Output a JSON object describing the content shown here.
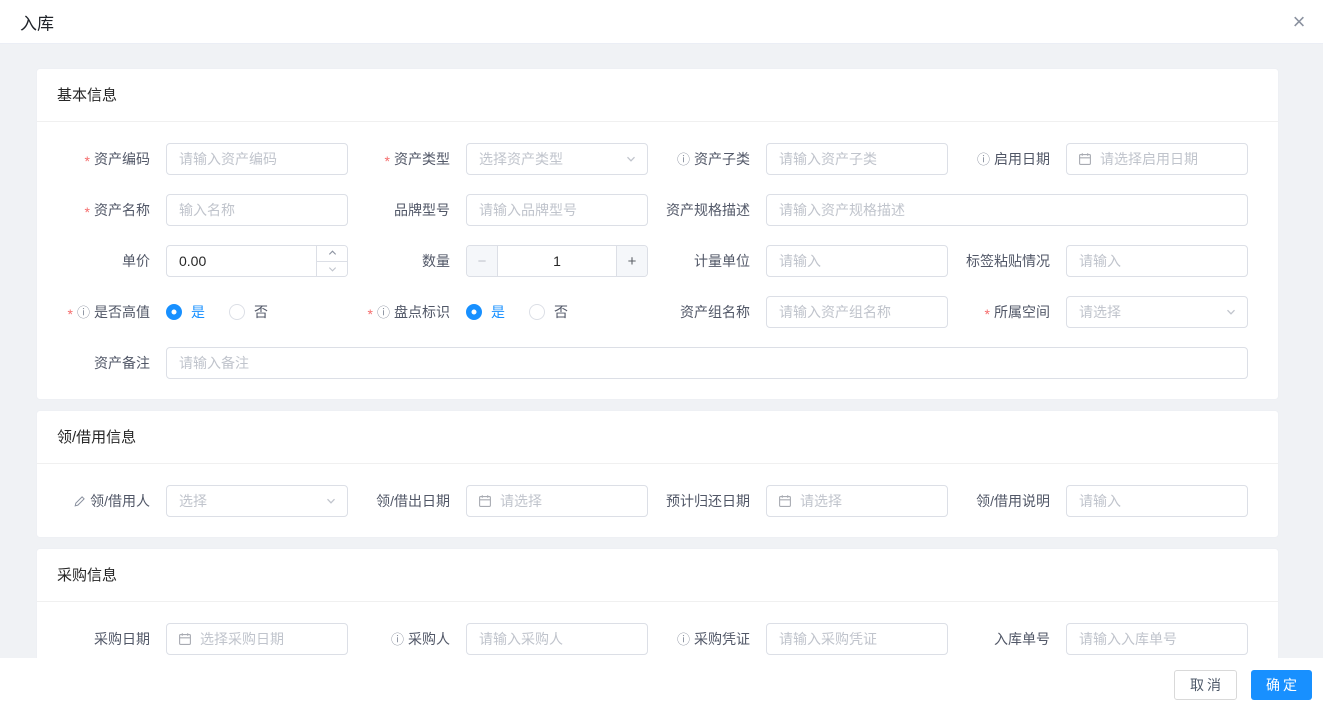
{
  "dialog": {
    "title": "入库"
  },
  "icons": {
    "close": "×",
    "info": "ⓘ",
    "required_mark": "*",
    "minus": "−",
    "plus": "+"
  },
  "colors": {
    "accent": "#1890ff",
    "required": "#f56c6c",
    "page_bg": "#f0f2f5"
  },
  "footer": {
    "cancel": "取消",
    "confirm": "确定"
  },
  "sections": [
    {
      "title": "基本信息",
      "rows": [
        {
          "fields": [
            {
              "label": "资产编码",
              "placeholder": "请输入资产编码"
            },
            {
              "label": "资产类型",
              "placeholder": "选择资产类型"
            },
            {
              "label": "资产子类",
              "placeholder": "请输入资产子类"
            },
            {
              "label": "启用日期",
              "placeholder": "请选择启用日期"
            }
          ]
        },
        {
          "fields": [
            {
              "label": "资产名称",
              "placeholder": "输入名称"
            },
            {
              "label": "品牌型号",
              "placeholder": "请输入品牌型号"
            },
            {
              "label": "资产规格描述",
              "placeholder": "请输入资产规格描述"
            }
          ]
        },
        {
          "fields": [
            {
              "label": "单价",
              "value": "0.00"
            },
            {
              "label": "数量",
              "value": "1"
            },
            {
              "label": "计量单位",
              "placeholder": "请输入"
            },
            {
              "label": "标签粘贴情况",
              "placeholder": "请输入"
            }
          ]
        },
        {
          "fields": [
            {
              "label": "是否高值",
              "options": [
                {
                  "label": "是"
                },
                {
                  "label": "否"
                }
              ]
            },
            {
              "label": "盘点标识",
              "options": [
                {
                  "label": "是"
                },
                {
                  "label": "否"
                }
              ]
            },
            {
              "label": "资产组名称",
              "placeholder": "请输入资产组名称"
            },
            {
              "label": "所属空间",
              "placeholder": "请选择"
            }
          ]
        },
        {
          "fields": [
            {
              "label": "资产备注",
              "placeholder": "请输入备注"
            }
          ]
        }
      ]
    },
    {
      "title": "领/借用信息",
      "rows": [
        {
          "fields": [
            {
              "label": "领/借用人",
              "placeholder": "选择"
            },
            {
              "label": "领/借出日期",
              "placeholder": "请选择"
            },
            {
              "label": "预计归还日期",
              "placeholder": "请选择"
            },
            {
              "label": "领/借用说明",
              "placeholder": "请输入"
            }
          ]
        }
      ]
    },
    {
      "title": "采购信息",
      "rows": [
        {
          "fields": [
            {
              "label": "采购日期",
              "placeholder": "选择采购日期"
            },
            {
              "label": "采购人",
              "placeholder": "请输入采购人"
            },
            {
              "label": "采购凭证",
              "placeholder": "请输入采购凭证"
            },
            {
              "label": "入库单号",
              "placeholder": "请输入入库单号"
            }
          ]
        }
      ]
    }
  ]
}
